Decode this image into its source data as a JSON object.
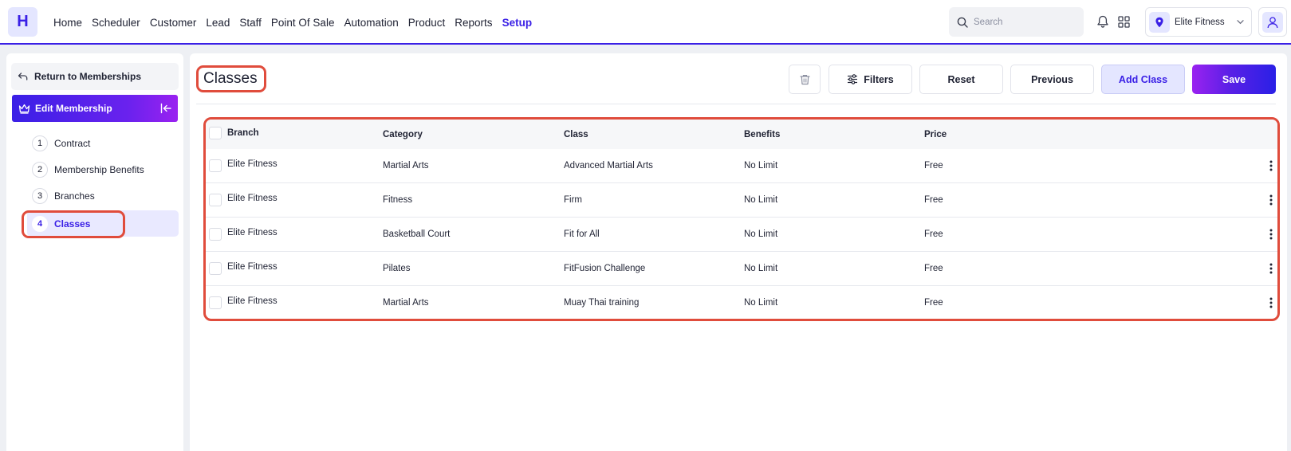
{
  "app": {
    "logo_letter": "H"
  },
  "nav": {
    "items": [
      "Home",
      "Scheduler",
      "Customer",
      "Lead",
      "Staff",
      "Point Of Sale",
      "Automation",
      "Product",
      "Reports",
      "Setup"
    ],
    "active": "Setup"
  },
  "search": {
    "placeholder": "Search"
  },
  "branch": {
    "selected": "Elite Fitness"
  },
  "sidebar": {
    "return_label": "Return to Memberships",
    "section_label": "Edit Membership",
    "steps": [
      {
        "num": "1",
        "label": "Contract"
      },
      {
        "num": "2",
        "label": "Membership Benefits"
      },
      {
        "num": "3",
        "label": "Branches"
      },
      {
        "num": "4",
        "label": "Classes"
      }
    ],
    "active_step": "4"
  },
  "main": {
    "title": "Classes",
    "buttons": {
      "filters": "Filters",
      "reset": "Reset",
      "previous": "Previous",
      "add_class": "Add Class",
      "save": "Save"
    }
  },
  "table": {
    "columns": [
      "Branch",
      "Category",
      "Class",
      "Benefits",
      "Price"
    ],
    "rows": [
      {
        "branch": "Elite Fitness",
        "category": "Martial Arts",
        "class": "Advanced Martial Arts",
        "benefits": "No Limit",
        "price": "Free"
      },
      {
        "branch": "Elite Fitness",
        "category": "Fitness",
        "class": "Firm",
        "benefits": "No Limit",
        "price": "Free"
      },
      {
        "branch": "Elite Fitness",
        "category": "Basketball Court",
        "class": "Fit for All",
        "benefits": "No Limit",
        "price": "Free"
      },
      {
        "branch": "Elite Fitness",
        "category": "Pilates",
        "class": "FitFusion Challenge",
        "benefits": "No Limit",
        "price": "Free"
      },
      {
        "branch": "Elite Fitness",
        "category": "Martial Arts",
        "class": "Muay Thai training",
        "benefits": "No Limit",
        "price": "Free"
      }
    ]
  },
  "colors": {
    "accent": "#3a20e6",
    "highlight": "#e04c3c",
    "accent_light": "#e4e6ff"
  },
  "icons": {
    "search": "search-icon",
    "bell": "bell-icon",
    "grid": "grid-icon",
    "pin": "location-pin-icon",
    "chevron": "chevron-down-icon",
    "user": "user-icon",
    "return": "return-arrow-icon",
    "crown": "crown-icon",
    "collapse": "collapse-sidebar-icon",
    "trash": "trash-icon",
    "filters": "sliders-icon",
    "kebab": "more-vertical-icon"
  }
}
